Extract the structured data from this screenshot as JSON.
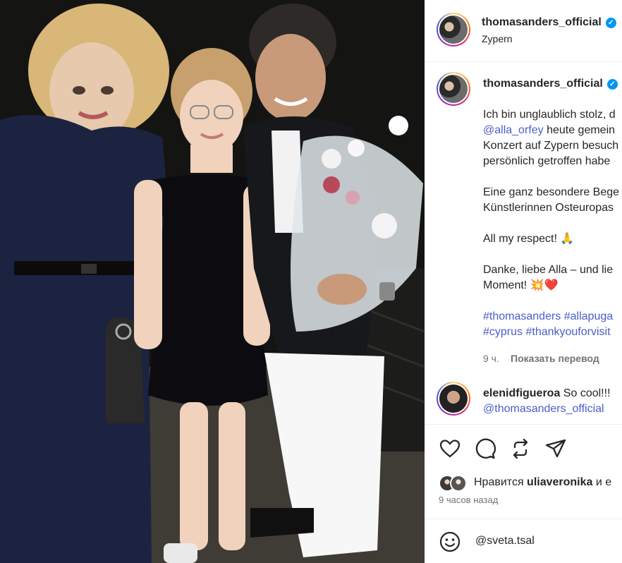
{
  "post": {
    "account": "thomasanders_official",
    "location": "Zypern",
    "verified_symbol": "✓"
  },
  "caption": {
    "line1": "Ich bin unglaublich stolz, d",
    "line2_mention": "@alla_orfey",
    "line2_rest": " heute gemein",
    "line3": "Konzert auf Zypern besuch",
    "line4": "persönlich getroffen habe",
    "line5": "Eine ganz besondere Bege",
    "line6": "Künstlerinnen Osteuropas",
    "line7": "All my respect! 🙏",
    "line8": "Danke, liebe Alla – und lie",
    "line9": "Moment! 💥❤️",
    "hashtags1": "#thomasanders #allapuga",
    "hashtags2": "#cyprus #thankyouforvisit",
    "time": "9 ч.",
    "translate": "Показать перевод"
  },
  "comment": {
    "user": "elenidfigueroa",
    "text": " So cool!!!",
    "mention": "@thomasanders_official"
  },
  "likes": {
    "prefix": "Нравится ",
    "user": "uliaveronika",
    "suffix": " и e"
  },
  "timestamp": "9 часов назад",
  "comment_input": {
    "value": "@sveta.tsal"
  },
  "icons": {
    "like": "heart-icon",
    "comment": "comment-bubble-icon",
    "repost": "repost-icon",
    "share": "send-icon",
    "emoji": "emoji-icon"
  },
  "colors": {
    "link": "#4a5ec8",
    "verified": "#0095f6",
    "muted": "#737373"
  }
}
